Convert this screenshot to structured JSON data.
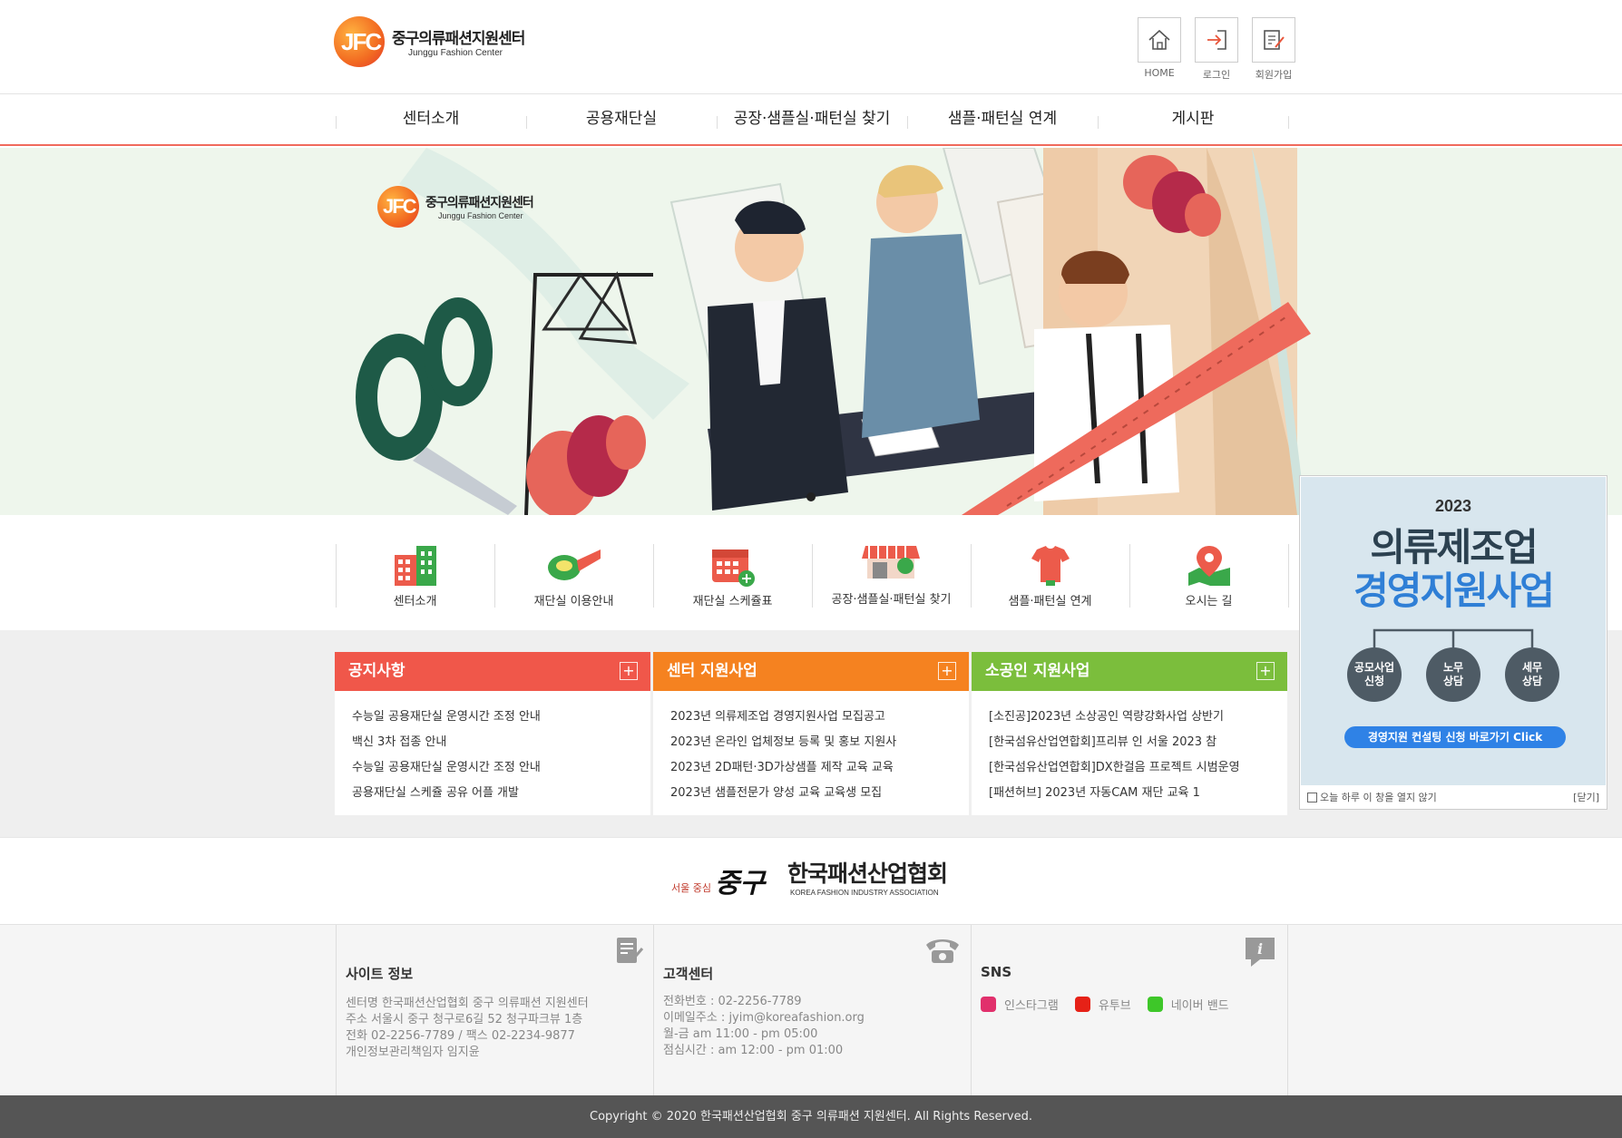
{
  "header": {
    "logo_name": "중구의류패션지원센터",
    "logo_en": "Junggu Fashion Center",
    "logo_mark": "JFC",
    "utils": [
      {
        "label": "HOME",
        "icon": "home-icon"
      },
      {
        "label": "로그인",
        "icon": "login-icon"
      },
      {
        "label": "회원가입",
        "icon": "signup-icon"
      }
    ]
  },
  "nav": {
    "items": [
      "센터소개",
      "공용재단실",
      "공장·샘플실·패턴실 찾기",
      "샘플·패턴실 연계",
      "게시판"
    ]
  },
  "banner": {
    "logo_name": "중구의류패션지원센터",
    "logo_en": "Junggu Fashion Center",
    "logo_mark": "JFC"
  },
  "quick": {
    "items": [
      {
        "label": "센터소개",
        "icon": "building-icon"
      },
      {
        "label": "재단실 이용안내",
        "icon": "measuring-tape-icon"
      },
      {
        "label": "재단실 스케쥴표",
        "icon": "calendar-icon"
      },
      {
        "label": "공장·샘플실·패턴실 찾기",
        "icon": "store-icon"
      },
      {
        "label": "샘플·패턴실 연계",
        "icon": "shirt-icon"
      },
      {
        "label": "오시는 길",
        "icon": "map-pin-icon"
      }
    ]
  },
  "boards": [
    {
      "title": "공지사항",
      "color": "#f0574a",
      "items": [
        "수능일 공용재단실 운영시간 조정 안내",
        "백신 3차 접종 안내",
        "수능일 공용재단실 운영시간 조정 안내",
        "공용재단실 스케쥴 공유 어플 개발"
      ]
    },
    {
      "title": "센터 지원사업",
      "color": "#f58220",
      "items": [
        "2023년 의류제조업 경영지원사업 모집공고",
        "2023년 온라인 업체정보 등록 및 홍보 지원사",
        "2023년 2D패턴·3D가상샘플 제작 교육 교육",
        "2023년 샘플전문가 양성 교육 교육생 모집"
      ]
    },
    {
      "title": "소공인 지원사업",
      "color": "#7bbe3c",
      "items": [
        "[소진공]2023년 소상공인 역량강화사업 상반기",
        "[한국섬유산업연합회]프리뷰 인 서울 2023 참",
        "[한국섬유산업연합회]DX한걸음 프로젝트 시범운영",
        "[패션허브] 2023년 자동CAM 재단 교육 1"
      ]
    }
  ],
  "board_plus": "+",
  "partners": {
    "junggu_slogan": "서울 중심",
    "junggu_name": "중구",
    "kfia_name": "한국패션산업협회",
    "kfia_en": "KOREA FASHION INDUSTRY ASSOCIATION"
  },
  "footer": {
    "site": {
      "title": "사이트 정보",
      "lines": [
        "센터명 한국패션산업협회 중구 의류패션 지원센터",
        "주소 서울시 중구 청구로6길 52 청구파크뷰 1층",
        "전화 02-2256-7789 / 팩스 02-2234-9877",
        "개인정보관리책임자 임지윤"
      ]
    },
    "cs": {
      "title": "고객센터",
      "lines": [
        "전화번호 : 02-2256-7789",
        "이메일주소 : jyim@koreafashion.org",
        "월-금 am 11:00 - pm 05:00",
        "점심시간 : am 12:00 - pm 01:00"
      ]
    },
    "sns": {
      "title": "SNS",
      "links": [
        {
          "label": "인스타그램",
          "color": "#e1306c",
          "icon": "instagram-icon"
        },
        {
          "label": "유투브",
          "color": "#e62117",
          "icon": "youtube-icon"
        },
        {
          "label": "네이버 밴드",
          "color": "#3ec729",
          "icon": "band-icon"
        }
      ]
    },
    "copyright": "Copyright © 2020 한국패션산업협회 중구 의류패션 지원센터. All Rights Reserved."
  },
  "popup": {
    "year": "2023",
    "title1": "의류제조업",
    "title2": "경영지원사업",
    "circles": [
      "공모사업\n신청",
      "노무\n상담",
      "세무\n상담"
    ],
    "button": "경영지원 컨설팅 신청 바로가기 Click",
    "dont_show": "오늘 하루 이 창을 열지 않기",
    "close": "[닫기]"
  },
  "colors": {
    "accent": "#f06a5c",
    "nav_border": "#f06a5c",
    "footer_bar": "#555555",
    "popup_bg": "#d8e6ee",
    "popup_blue": "#2f7fd6"
  }
}
